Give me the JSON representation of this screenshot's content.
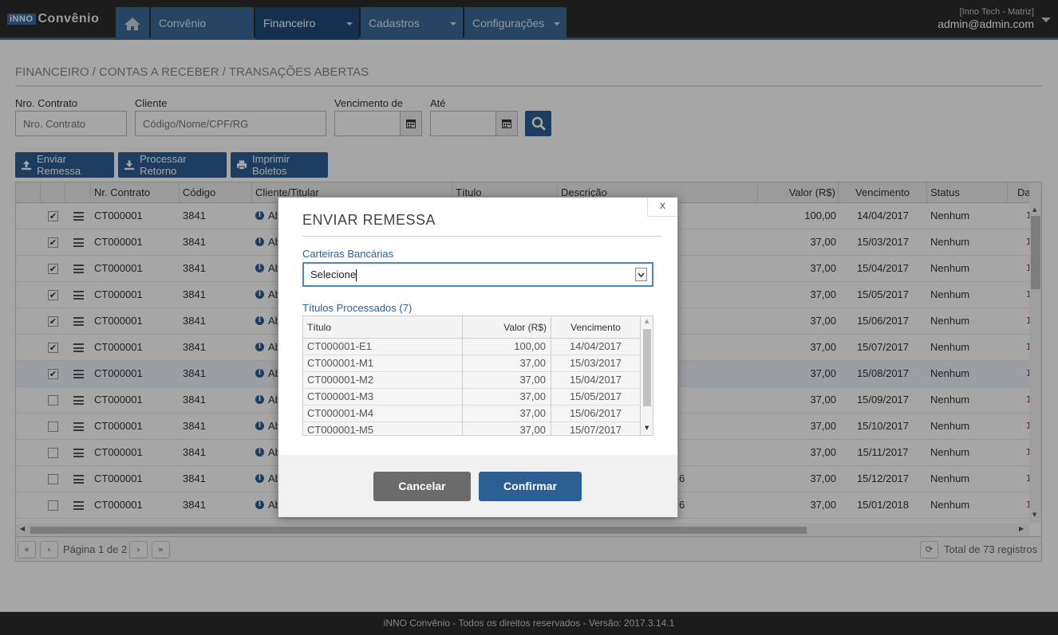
{
  "app": {
    "logo_box": "iNNO",
    "logo_text": "Convênio"
  },
  "nav": {
    "home_icon": "home-icon",
    "items": [
      {
        "label": "Convênio"
      },
      {
        "label": "Financeiro"
      },
      {
        "label": "Cadastros"
      },
      {
        "label": "Configurações"
      }
    ]
  },
  "user": {
    "org": "[Inno Tech - Matriz]",
    "email": "admin@admin.com"
  },
  "breadcrumb": "FINANCEIRO / CONTAS A RECEBER / TRANSAÇÕES ABERTAS",
  "filters": {
    "contrato_label": "Nro. Contrato",
    "contrato_placeholder": "Nro. Contrato",
    "cliente_label": "Cliente",
    "cliente_placeholder": "Código/Nome/CPF/RG",
    "venc_label": "Vencimento de",
    "ate_label": "Até"
  },
  "actions": {
    "enviar": "Enviar Remessa",
    "processar": "Processar Retorno",
    "imprimir": "Imprimir Boletos"
  },
  "grid": {
    "columns": [
      "Nr. Contrato",
      "Código",
      "Cliente/Titular",
      "Título",
      "Descrição",
      "Valor (R$)",
      "Vencimento",
      "Status",
      "Da"
    ],
    "rows": [
      {
        "checked": "✔",
        "contrato": "CT000001",
        "codigo": "3841",
        "cliente": "Ab",
        "desc": "",
        "valor": "100,00",
        "venc": "14/04/2017",
        "status": "Nenhum",
        "da": "1"
      },
      {
        "checked": "✔",
        "contrato": "CT000001",
        "codigo": "3841",
        "cliente": "Ab",
        "desc": "",
        "valor": "37,00",
        "venc": "15/03/2017",
        "status": "Nenhum",
        "da": "1"
      },
      {
        "checked": "✔",
        "contrato": "CT000001",
        "codigo": "3841",
        "cliente": "Ab",
        "desc": "",
        "valor": "37,00",
        "venc": "15/04/2017",
        "status": "Nenhum",
        "da": "1"
      },
      {
        "checked": "✔",
        "contrato": "CT000001",
        "codigo": "3841",
        "cliente": "Ab",
        "desc": "",
        "valor": "37,00",
        "venc": "15/05/2017",
        "status": "Nenhum",
        "da": "1"
      },
      {
        "checked": "✔",
        "contrato": "CT000001",
        "codigo": "3841",
        "cliente": "Ab",
        "desc": "",
        "valor": "37,00",
        "venc": "15/06/2017",
        "status": "Nenhum",
        "da": "1"
      },
      {
        "checked": "✔",
        "contrato": "CT000001",
        "codigo": "3841",
        "cliente": "Ab",
        "desc": "",
        "valor": "37,00",
        "venc": "15/07/2017",
        "status": "Nenhum",
        "da": "1"
      },
      {
        "checked": "✔",
        "contrato": "CT000001",
        "codigo": "3841",
        "cliente": "Ab",
        "desc": "",
        "valor": "37,00",
        "venc": "15/08/2017",
        "status": "Nenhum",
        "da": "1"
      },
      {
        "checked": "",
        "contrato": "CT000001",
        "codigo": "3841",
        "cliente": "Ab",
        "desc": "",
        "valor": "37,00",
        "venc": "15/09/2017",
        "status": "Nenhum",
        "da": "1"
      },
      {
        "checked": "",
        "contrato": "CT000001",
        "codigo": "3841",
        "cliente": "Ab",
        "desc": "",
        "valor": "37,00",
        "venc": "15/10/2017",
        "status": "Nenhum",
        "da": "1"
      },
      {
        "checked": "",
        "contrato": "CT000001",
        "codigo": "3841",
        "cliente": "Ab",
        "desc": "",
        "valor": "37,00",
        "venc": "15/11/2017",
        "status": "Nenhum",
        "da": "1"
      },
      {
        "checked": "",
        "contrato": "CT000001",
        "codigo": "3841",
        "cliente": "Ab",
        "desc": "6",
        "valor": "37,00",
        "venc": "15/12/2017",
        "status": "Nenhum",
        "da": "1"
      },
      {
        "checked": "",
        "contrato": "CT000001",
        "codigo": "3841",
        "cliente": "Ab",
        "desc": "6",
        "valor": "37,00",
        "venc": "15/01/2018",
        "status": "Nenhum",
        "da": "1"
      }
    ]
  },
  "pager": {
    "page_text": "Página 1 de 2",
    "total": "Total de 73 registros"
  },
  "modal": {
    "title": "ENVIAR REMESSA",
    "close": "x",
    "carteiras_label": "Carteiras Bancárias",
    "carteiras_value": "Selecione",
    "titulos_label": "Títulos Processados (7)",
    "columns": [
      "Título",
      "Valor (R$)",
      "Vencimento"
    ],
    "rows": [
      {
        "titulo": "CT000001-E1",
        "valor": "100,00",
        "venc": "14/04/2017"
      },
      {
        "titulo": "CT000001-M1",
        "valor": "37,00",
        "venc": "15/03/2017"
      },
      {
        "titulo": "CT000001-M2",
        "valor": "37,00",
        "venc": "15/04/2017"
      },
      {
        "titulo": "CT000001-M3",
        "valor": "37,00",
        "venc": "15/05/2017"
      },
      {
        "titulo": "CT000001-M4",
        "valor": "37,00",
        "venc": "15/06/2017"
      },
      {
        "titulo": "CT000001-M5",
        "valor": "37,00",
        "venc": "15/07/2017"
      }
    ],
    "cancel": "Cancelar",
    "confirm": "Confirmar"
  },
  "footer": "iNNO Convênio - Todos os direitos reservados - Versão: 2017.3.14.1",
  "colors": {
    "primary": "#2b5f94",
    "nav_bg": "#2c2c2c",
    "nav_item": "#3d6b99",
    "nav_active": "#1f4b78",
    "cancel": "#6b6b6b"
  }
}
